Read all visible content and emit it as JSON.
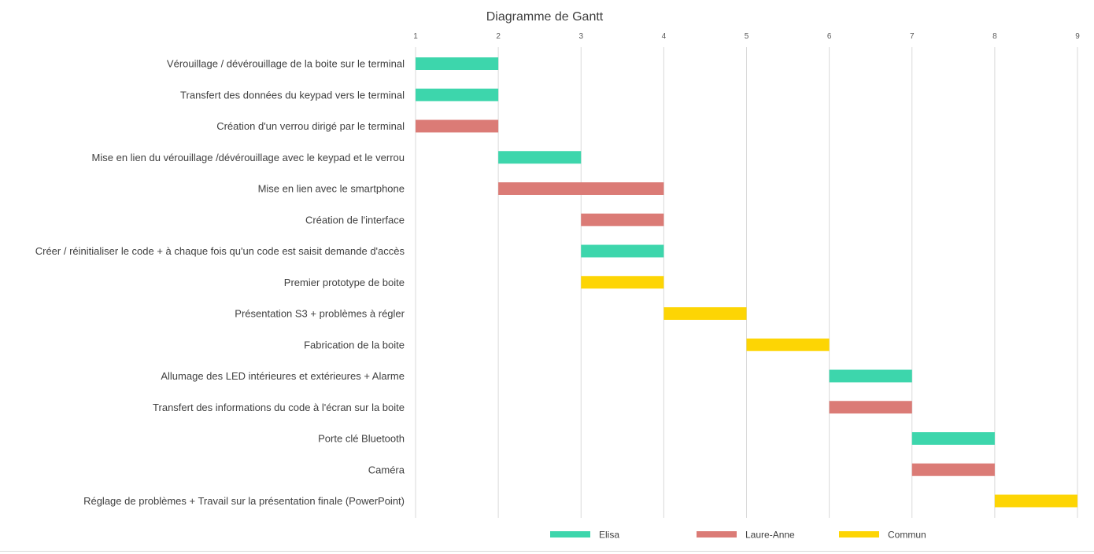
{
  "chart_data": {
    "type": "gantt",
    "title": "Diagramme de Gantt",
    "xlim": [
      1,
      9
    ],
    "x_ticks": [
      "1",
      "2",
      "3",
      "4",
      "5",
      "6",
      "7",
      "8",
      "9"
    ],
    "grid": true,
    "legend_position": "bottom",
    "series": [
      {
        "name": "Elisa",
        "color": "#3dd6ac"
      },
      {
        "name": "Laure-Anne",
        "color": "#db7b76"
      },
      {
        "name": "Commun",
        "color": "#fdd504"
      }
    ],
    "tasks": [
      {
        "label": "Vérouillage / dévérouillage de la boite sur le terminal",
        "start": 1,
        "end": 2,
        "series": "Elisa"
      },
      {
        "label": "Transfert des données du keypad vers le terminal",
        "start": 1,
        "end": 2,
        "series": "Elisa"
      },
      {
        "label": "Création d'un verrou dirigé par le terminal",
        "start": 1,
        "end": 2,
        "series": "Laure-Anne"
      },
      {
        "label": "Mise en lien du vérouillage /dévérouillage avec le keypad et le verrou",
        "start": 2,
        "end": 3,
        "series": "Elisa"
      },
      {
        "label": "Mise en lien avec le smartphone",
        "start": 2,
        "end": 4,
        "series": "Laure-Anne"
      },
      {
        "label": "Création de l'interface",
        "start": 3,
        "end": 4,
        "series": "Laure-Anne"
      },
      {
        "label": "Créer / réinitialiser le code + à chaque fois qu'un code est saisit demande d'accès",
        "start": 3,
        "end": 4,
        "series": "Elisa"
      },
      {
        "label": "Premier prototype de boite",
        "start": 3,
        "end": 4,
        "series": "Commun"
      },
      {
        "label": "Présentation S3 + problèmes à régler",
        "start": 4,
        "end": 5,
        "series": "Commun"
      },
      {
        "label": "Fabrication de la boite",
        "start": 5,
        "end": 6,
        "series": "Commun"
      },
      {
        "label": "Allumage des LED intérieures et extérieures + Alarme",
        "start": 6,
        "end": 7,
        "series": "Elisa"
      },
      {
        "label": "Transfert des informations du code à l'écran sur la boite",
        "start": 6,
        "end": 7,
        "series": "Laure-Anne"
      },
      {
        "label": "Porte clé Bluetooth",
        "start": 7,
        "end": 8,
        "series": "Elisa"
      },
      {
        "label": "Caméra",
        "start": 7,
        "end": 8,
        "series": "Laure-Anne"
      },
      {
        "label": "Réglage de problèmes + Travail sur la présentation finale (PowerPoint)",
        "start": 8,
        "end": 9,
        "series": "Commun"
      }
    ]
  }
}
